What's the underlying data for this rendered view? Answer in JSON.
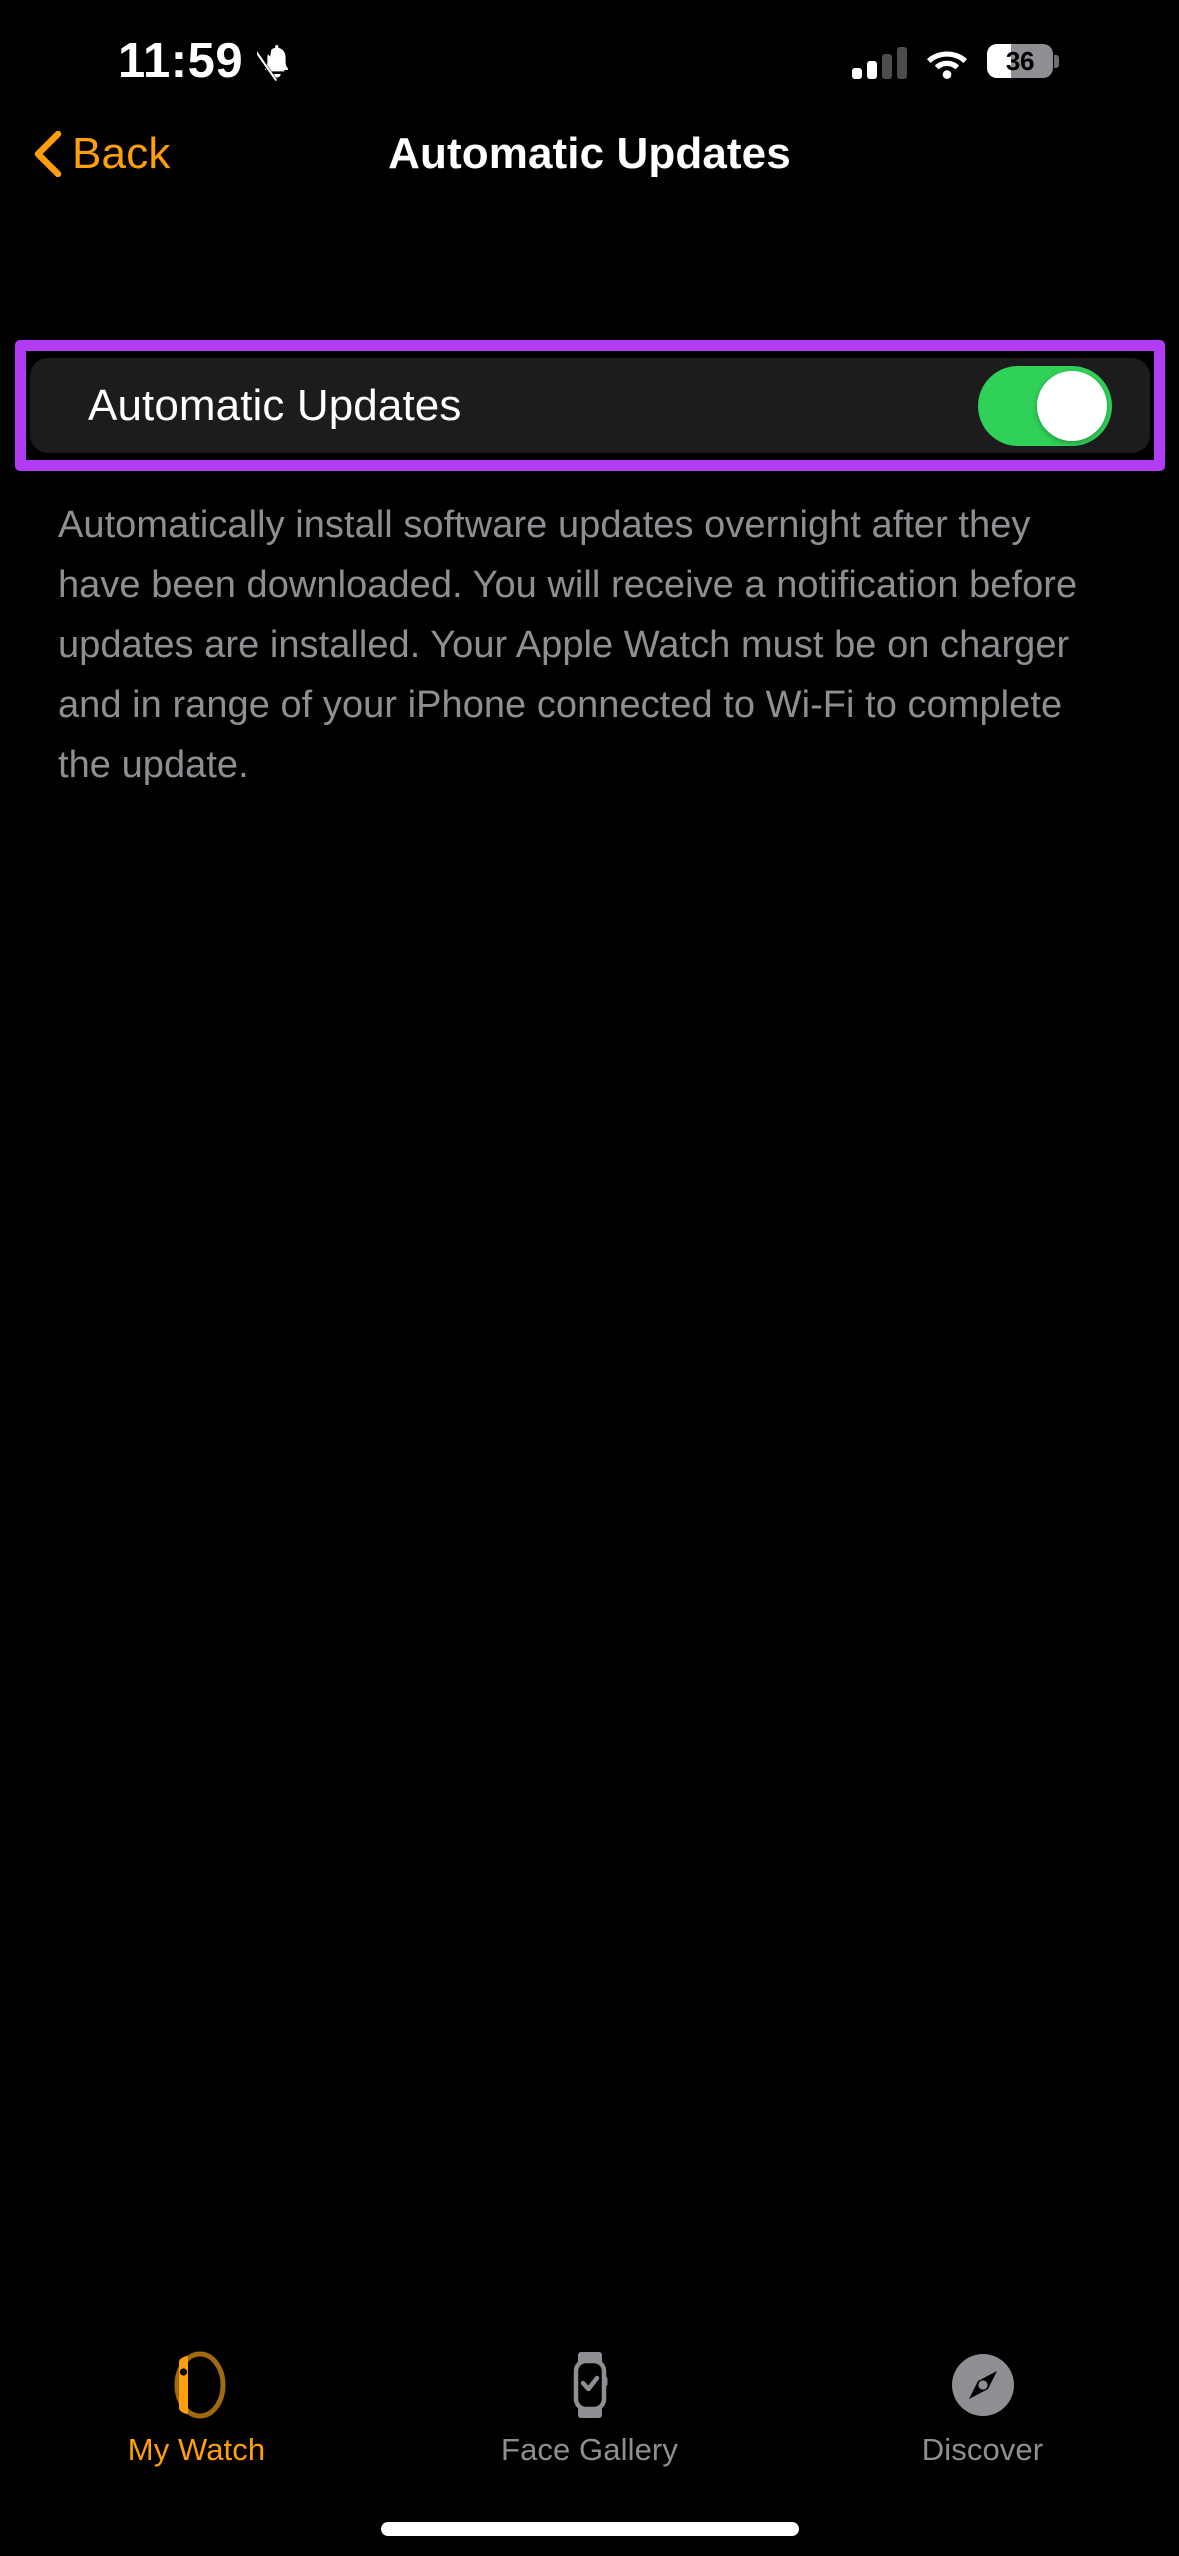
{
  "status_bar": {
    "time": "11:59",
    "silent_icon": "bell-slash-icon",
    "cellular_icon": "cellular-signal-icon",
    "cellular_bars_active": 2,
    "cellular_bars_total": 4,
    "wifi_icon": "wifi-icon",
    "battery_icon": "battery-icon",
    "battery_percent": "36"
  },
  "nav": {
    "back_label": "Back",
    "back_icon": "chevron-left-icon",
    "title": "Automatic Updates",
    "accent_color": "#ff9f0a"
  },
  "highlight": {
    "color": "#b23cf5"
  },
  "settings": {
    "row": {
      "label": "Automatic Updates",
      "toggle_state": "on",
      "toggle_on_color": "#30d158"
    },
    "footer_note": "Automatically install software updates overnight after they have been downloaded. You will receive a notification before updates are installed. Your Apple Watch must be on charger and in range of your iPhone connected to Wi-Fi to complete the update."
  },
  "tab_bar": {
    "tabs": [
      {
        "label": "My Watch",
        "icon": "apple-watch-icon",
        "active": true
      },
      {
        "label": "Face Gallery",
        "icon": "watch-face-icon",
        "active": false
      },
      {
        "label": "Discover",
        "icon": "compass-icon",
        "active": false
      }
    ],
    "active_color": "#ff9f0a",
    "inactive_color": "#8e8e93"
  },
  "home_indicator": {
    "name": "home-indicator"
  }
}
